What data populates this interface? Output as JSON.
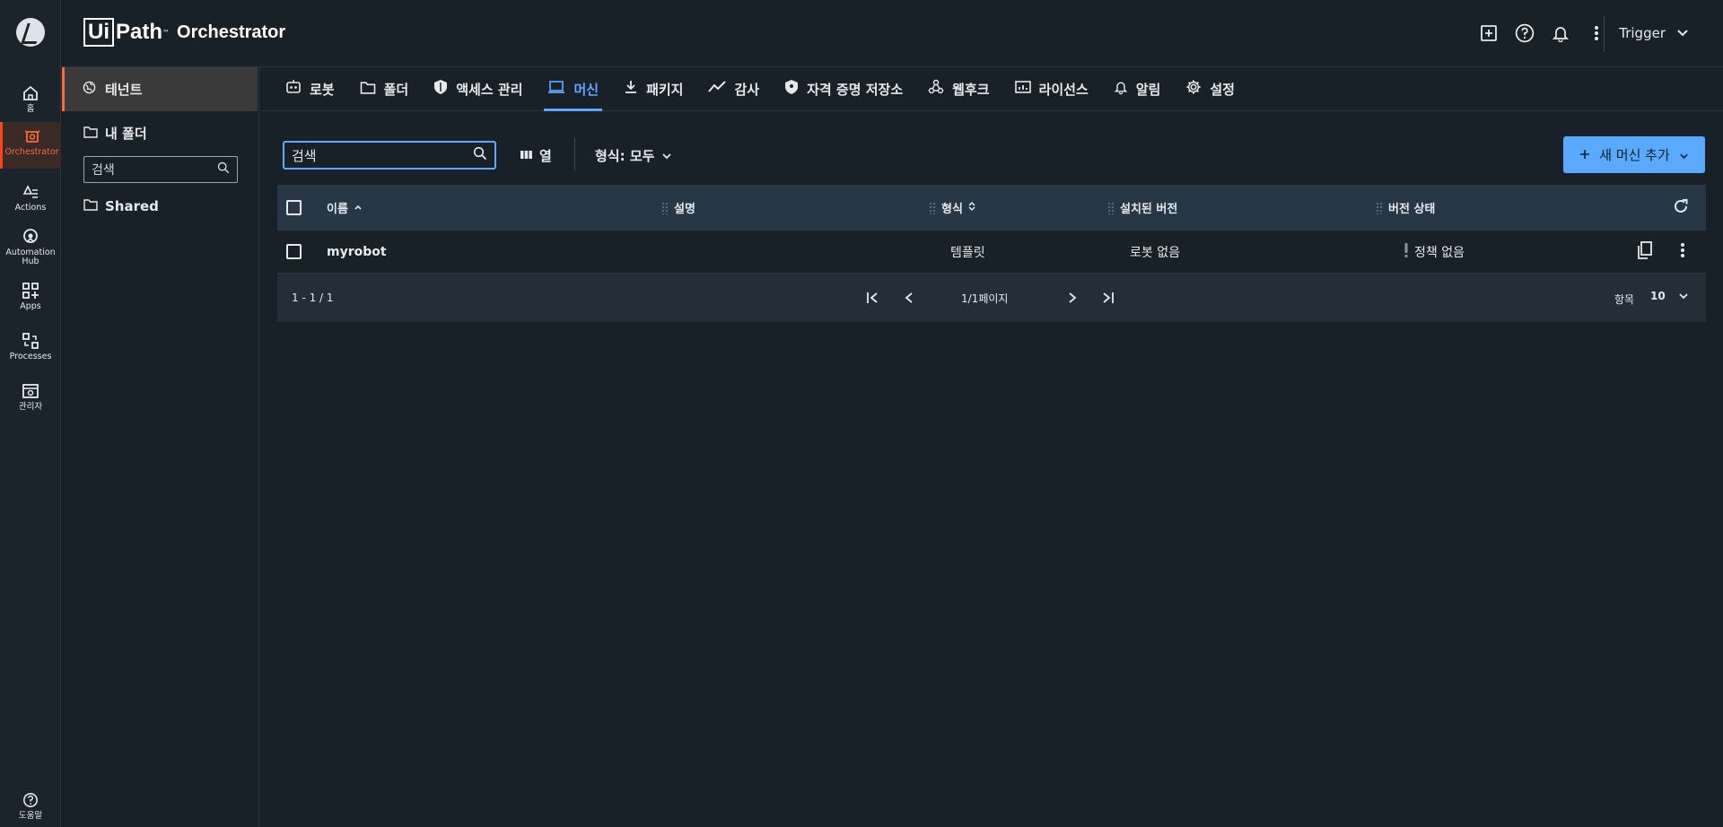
{
  "header": {
    "brand_box": "Ui",
    "brand_path": "Path",
    "brand_tm": "™",
    "brand_product": "Orchestrator",
    "tenant_selector": "Trigger"
  },
  "rail": {
    "items": [
      {
        "label": "홈",
        "icon": "home-icon"
      },
      {
        "label": "Orchestrator",
        "icon": "orchestrator-icon"
      },
      {
        "label": "Actions",
        "icon": "actions-icon"
      },
      {
        "label": "Automation Hub",
        "icon": "automation-hub-icon"
      },
      {
        "label": "Apps",
        "icon": "apps-icon"
      },
      {
        "label": "Processes",
        "icon": "processes-icon"
      },
      {
        "label": "관리자",
        "icon": "admin-icon"
      }
    ],
    "help_label": "도움말"
  },
  "folders": {
    "tenant_label": "테넌트",
    "my_folder_label": "내 폴더",
    "search_placeholder": "검색",
    "shared_label": "Shared"
  },
  "tabs": [
    {
      "label": "로봇",
      "icon": "robot-icon"
    },
    {
      "label": "폴더",
      "icon": "folder-icon"
    },
    {
      "label": "액세스 관리",
      "icon": "shield-icon"
    },
    {
      "label": "머신",
      "icon": "laptop-icon",
      "active": true
    },
    {
      "label": "패키지",
      "icon": "download-icon"
    },
    {
      "label": "감사",
      "icon": "trend-icon"
    },
    {
      "label": "자격 증명 저장소",
      "icon": "shield-icon"
    },
    {
      "label": "웹후크",
      "icon": "webhook-icon"
    },
    {
      "label": "라이선스",
      "icon": "license-icon"
    },
    {
      "label": "알림",
      "icon": "bell-icon"
    },
    {
      "label": "설정",
      "icon": "gear-icon"
    }
  ],
  "toolbar": {
    "search_placeholder": "검색",
    "columns_label": "열",
    "type_filter_label": "형식: 모두",
    "add_button_label": "새 머신 추가"
  },
  "table": {
    "columns": [
      "이름",
      "설명",
      "형식",
      "설치된 버전",
      "버전 상태"
    ],
    "rows": [
      {
        "name": "myrobot",
        "description": "",
        "type": "템플릿",
        "installed_version": "로봇 없음",
        "version_status": "정책 없음"
      }
    ]
  },
  "pager": {
    "range": "1 - 1 / 1",
    "page_label": "1/1페이지",
    "items_label": "항목",
    "items_per_page": "10"
  },
  "colors": {
    "background": "#182028",
    "accent_blue": "#5aa9ff",
    "accent_orange": "#fa4616",
    "table_header": "#283746"
  }
}
